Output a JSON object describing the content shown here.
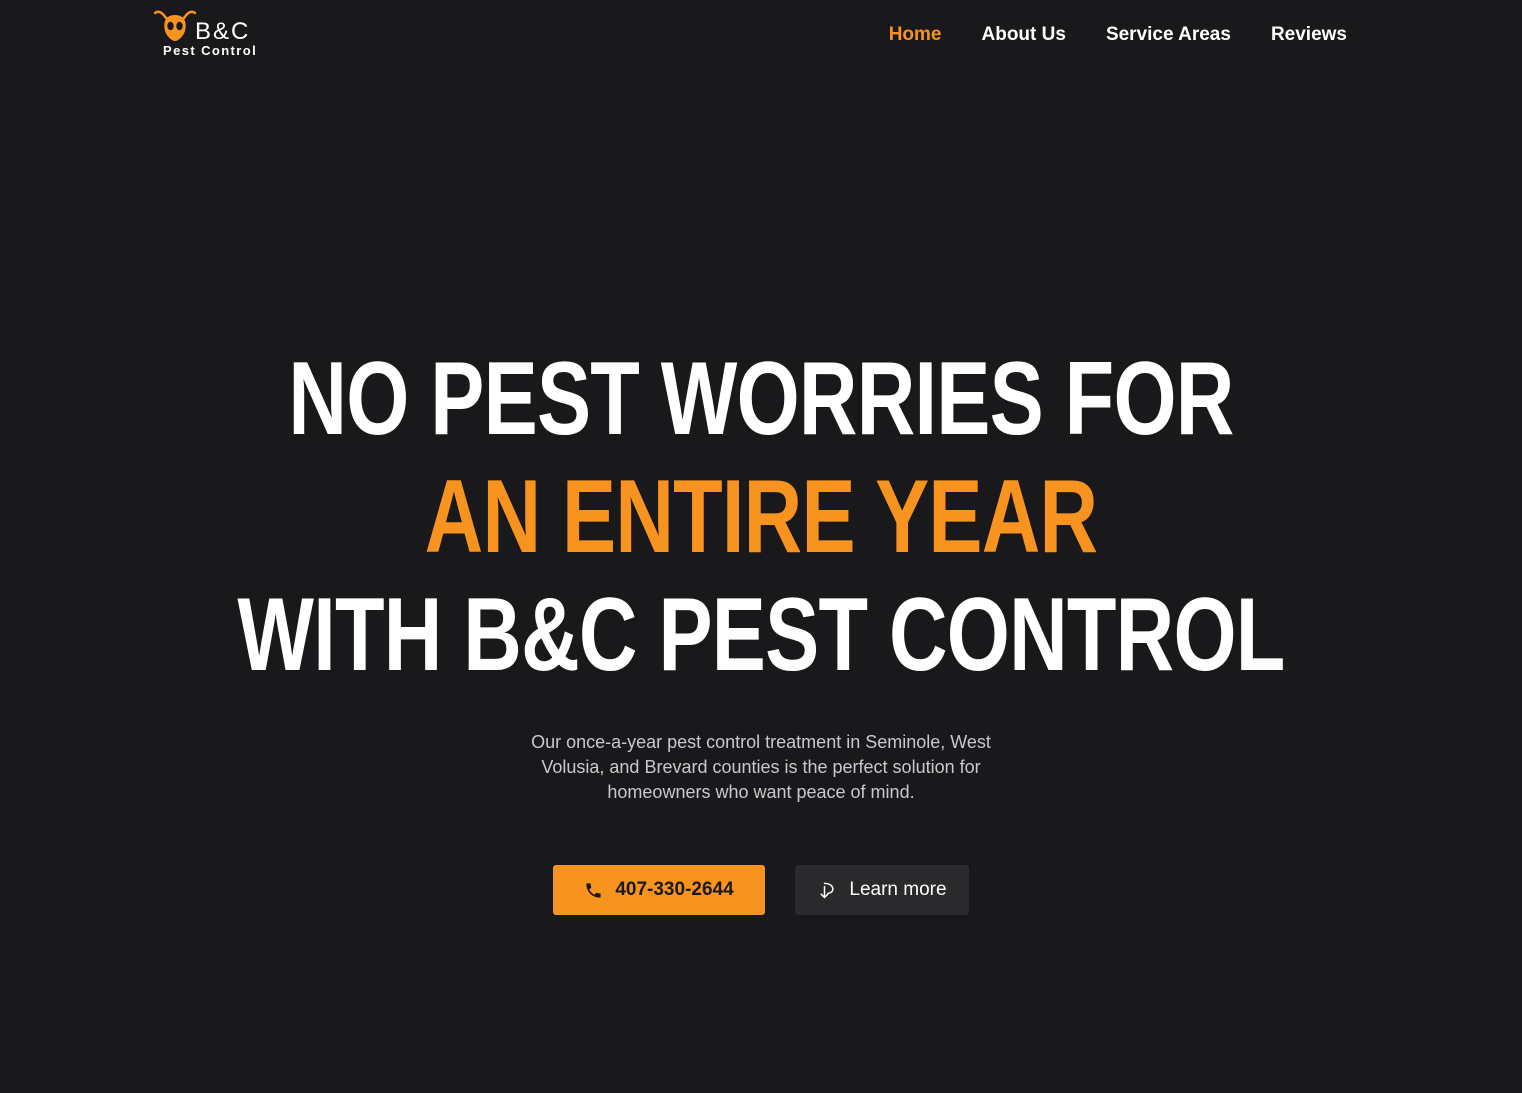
{
  "header": {
    "logo": {
      "mark_text": "B&C",
      "sub_text": "Pest Control"
    },
    "nav": [
      {
        "label": "Home",
        "active": true
      },
      {
        "label": "About Us",
        "active": false
      },
      {
        "label": "Service Areas",
        "active": false
      },
      {
        "label": "Reviews",
        "active": false
      }
    ]
  },
  "hero": {
    "title_line1": "No Pest Worries For",
    "title_line2": "An Entire Year",
    "title_line3": "With B&C Pest Control",
    "subtitle": "Our once-a-year pest control treatment in Seminole, West Volusia, and Brevard counties is the perfect solution for homeowners who want peace of mind.",
    "call_button": {
      "label": "407-330-2644",
      "icon": "phone-icon"
    },
    "learn_button": {
      "label": "Learn more",
      "icon": "arrow-down-curve-icon"
    }
  },
  "colors": {
    "background": "#19191b",
    "accent": "#f7931e",
    "text": "#ffffff",
    "muted_text": "#c9c9cc",
    "secondary_button": "#2a2a2d"
  }
}
